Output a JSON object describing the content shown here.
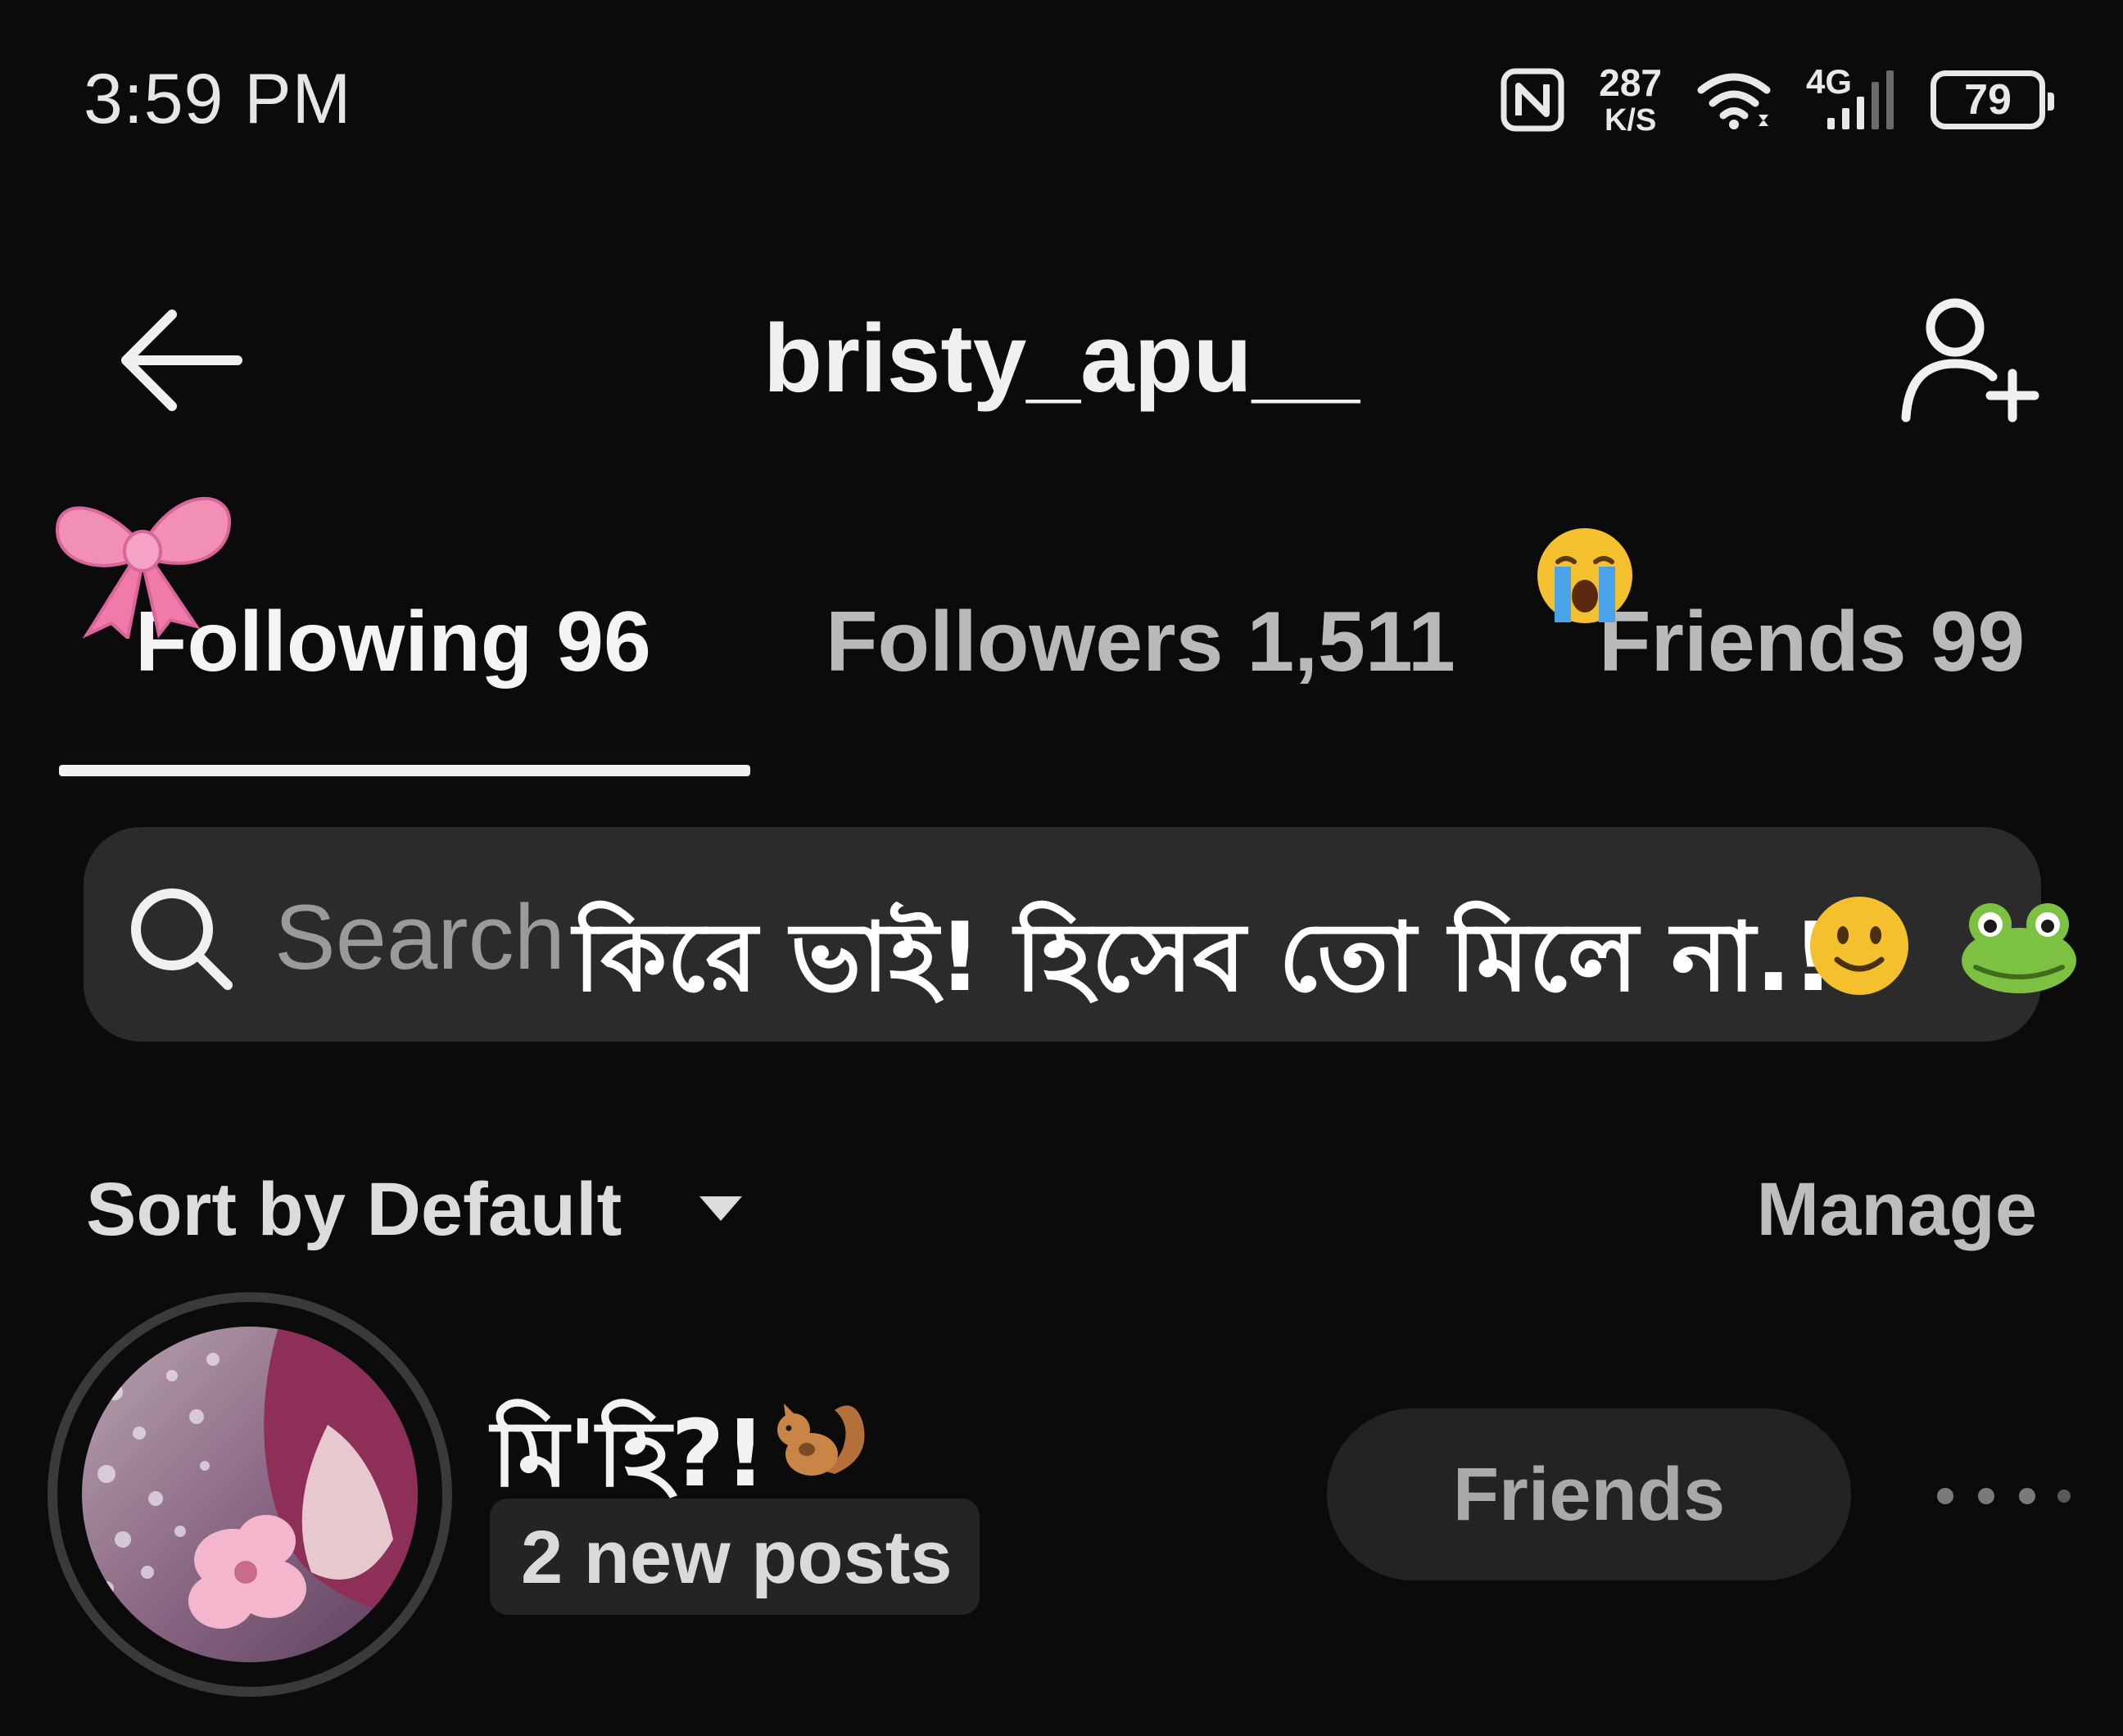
{
  "status_bar": {
    "time": "3:59 PM",
    "network_speed_value": "287",
    "network_speed_unit": "K/S",
    "network_type": "4G",
    "battery_level": "79",
    "icons": [
      "nfc-icon",
      "wifi-icon",
      "signal-icon",
      "battery-icon"
    ]
  },
  "header": {
    "title": "bristy_apu__",
    "back_icon": "back-arrow-icon",
    "add_user_icon": "add-user-icon"
  },
  "tabs": [
    {
      "label": "Following 96",
      "active": true
    },
    {
      "label": "Followers 1,511",
      "active": false
    },
    {
      "label": "Friends 99",
      "active": false
    }
  ],
  "stickers": {
    "bow": "pink-bow-icon",
    "crying": "crying-face-emoji",
    "smile": "slightly-smiling-face-emoji",
    "frog": "frog-face-emoji",
    "squirrel": "squirrel-emoji"
  },
  "search": {
    "placeholder": "Search",
    "overlay_caption": "কিরে ভাই! হিসেব তো মিলে না.!!"
  },
  "sort": {
    "label": "Sort by Default",
    "manage_label": "Manage"
  },
  "list": [
    {
      "name": "মি'হি?!",
      "subtitle": "2 new posts",
      "button_label": "Friends"
    }
  ],
  "colors": {
    "background": "#0b0b0b",
    "search_bg": "#2b2b2b",
    "bow_pink": "#f28fb5",
    "emoji_yellow": "#f5c02e",
    "frog_green": "#7cc142"
  }
}
